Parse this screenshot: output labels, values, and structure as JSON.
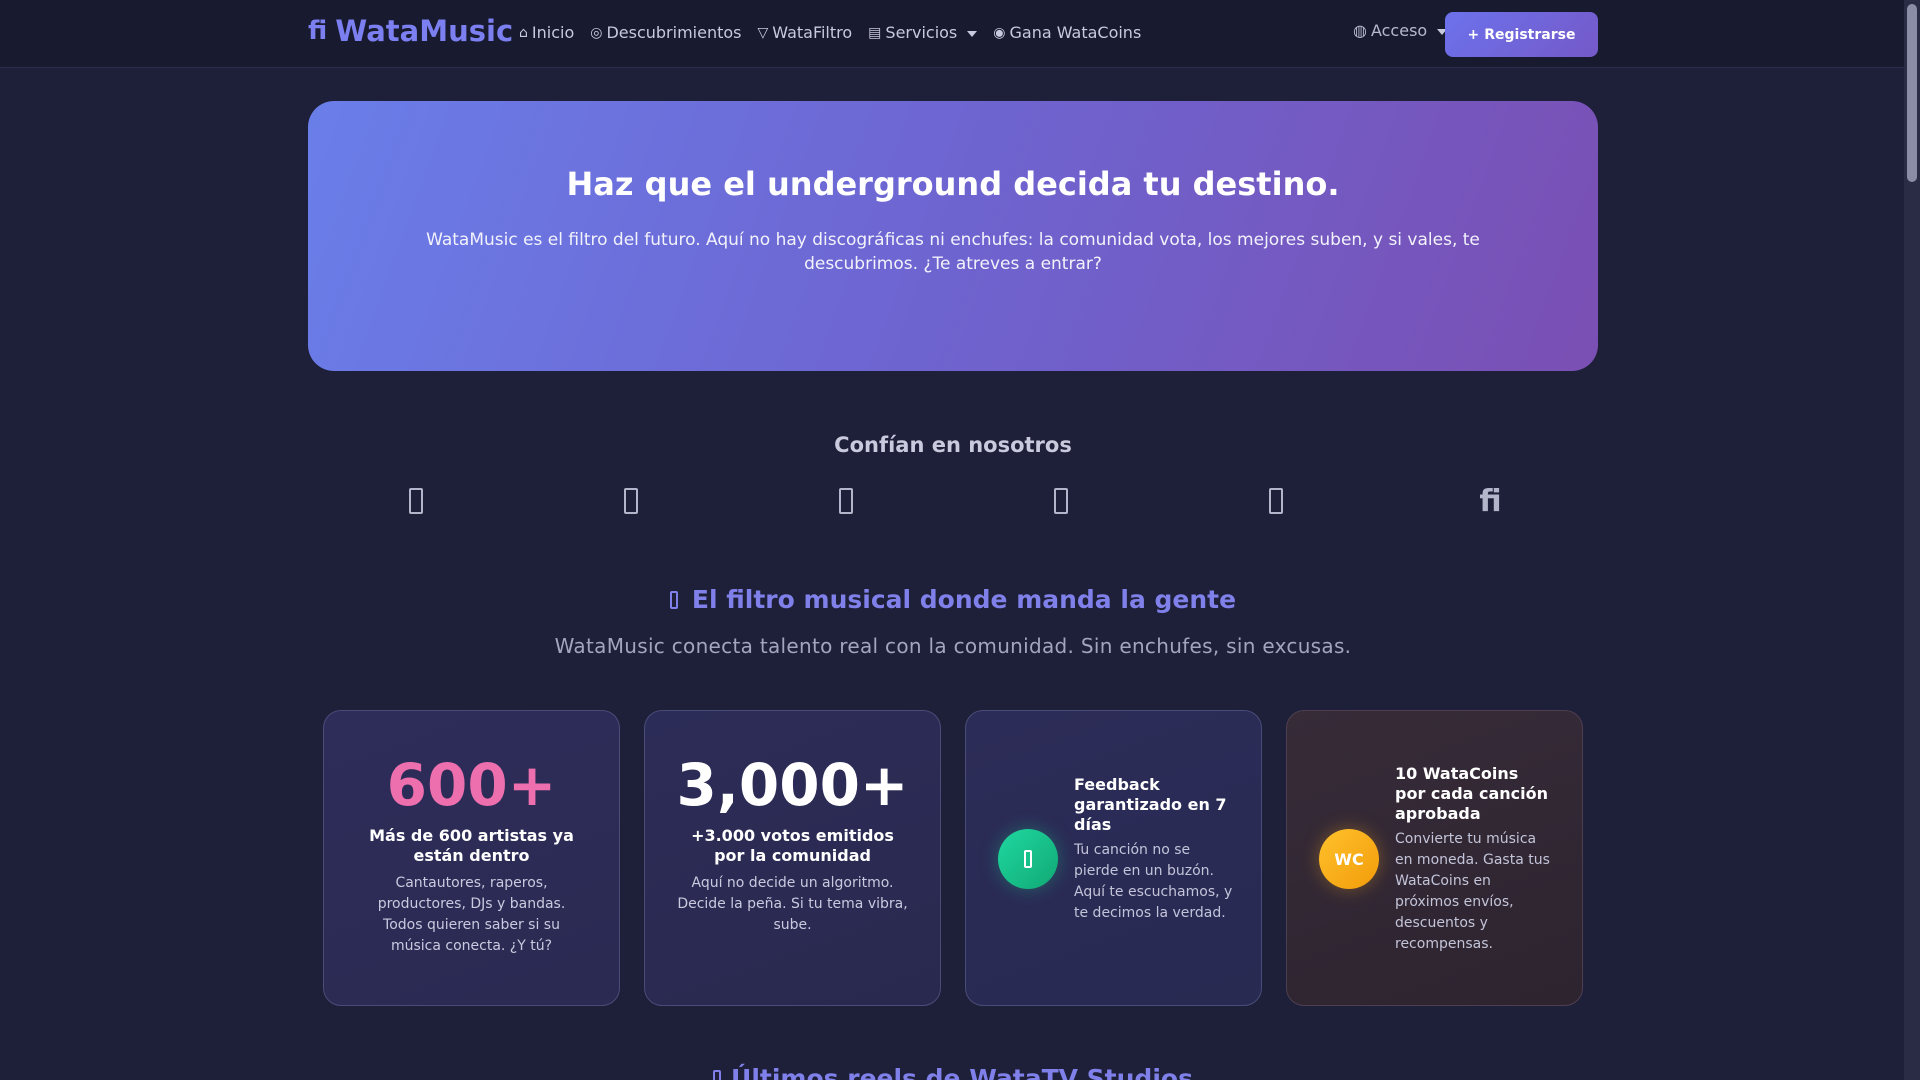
{
  "nav": {
    "brand": "WataMusic",
    "brand_icon": "fi",
    "links": [
      {
        "label": "Inicio",
        "icon": "home-icon"
      },
      {
        "label": "Descubrimientos",
        "icon": "compass-icon"
      },
      {
        "label": "WataFiltro",
        "icon": "filter-icon"
      },
      {
        "label": "Servicios",
        "icon": "services-icon",
        "dropdown": true
      },
      {
        "label": "Gana WataCoins",
        "icon": "coin-icon"
      }
    ],
    "login": {
      "label": "Acceso",
      "icon": "user-icon",
      "dropdown": true
    },
    "register": {
      "label": "Registrarse",
      "icon": "user-plus-icon"
    }
  },
  "hero": {
    "title": "Haz que el underground decida tu destino.",
    "text": "WataMusic es el filtro del futuro. Aquí no hay discográficas ni enchufes: la comunidad vota, los mejores suben, y si vales, te descubrimos. ¿Te atreves a entrar?"
  },
  "trust": {
    "title": "Confían en nosotros",
    "logos": [
      "partner-logo-icon",
      "partner-logo-icon",
      "partner-logo-icon",
      "partner-logo-icon",
      "partner-logo-icon",
      "fi"
    ]
  },
  "section": {
    "title": "El filtro musical donde manda la gente",
    "subtitle": "WataMusic conecta talento real con la comunidad. Sin enchufes, sin excusas."
  },
  "stats": [
    {
      "number": "600+",
      "title": "Más de 600 artistas ya están dentro",
      "text": "Cantautores, raperos, productores, DJs y bandas. Todos quieren saber si su música conecta. ¿Y tú?"
    },
    {
      "number": "3,000+",
      "title": "+3.000 votos emitidos por la comunidad",
      "text": "Aquí no decide un algoritmo. Decide la peña. Si tu tema vibra, sube."
    }
  ],
  "features": [
    {
      "icon": "clock-icon",
      "title": "Feedback garantizado en 7 días",
      "text": "Tu canción no se pierde en un buzón. Aquí te escuchamos, y te decimos la verdad."
    },
    {
      "icon_text": "WC",
      "title": "10 WataCoins por cada canción aprobada",
      "text": "Convierte tu música en moneda. Gasta tus WataCoins en próximos envíos, descuentos y recompensas."
    }
  ],
  "next_section": {
    "title": "Últimos reels de WataTV Studios"
  },
  "colors": {
    "background": "#1e1f38",
    "navbar": "#181a30",
    "brand": "#7b7ff0",
    "accent_pink": "#ee6fae",
    "accent_green": "#1fd8a0",
    "accent_gold": "#ffc22c",
    "hero_gradient_start": "#6a7ee9",
    "hero_gradient_end": "#7a4fb3"
  }
}
